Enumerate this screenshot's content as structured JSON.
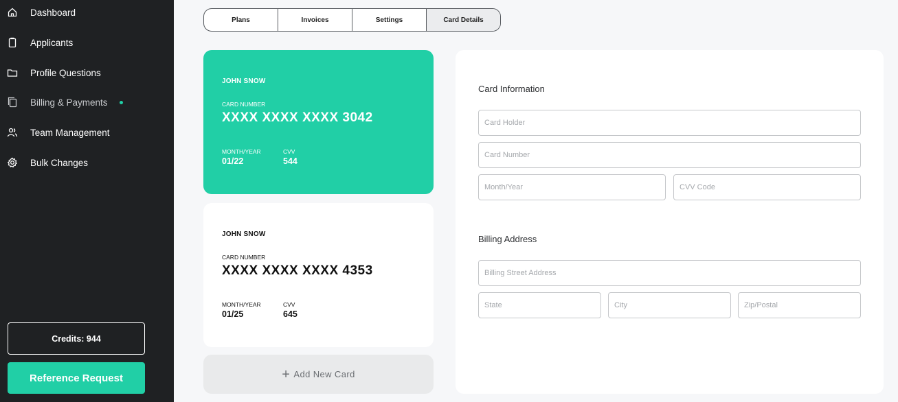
{
  "sidebar": {
    "items": [
      {
        "label": "Dashboard",
        "icon": "home-icon"
      },
      {
        "label": "Applicants",
        "icon": "clipboard-icon"
      },
      {
        "label": "Profile Questions",
        "icon": "folder-icon"
      },
      {
        "label": "Billing & Payments",
        "icon": "copy-icon"
      },
      {
        "label": "Team Management",
        "icon": "users-icon"
      },
      {
        "label": "Bulk Changes",
        "icon": "gear-icon"
      }
    ],
    "credits_label": "Credits: 944",
    "reference_button": "Reference Request"
  },
  "tabs": [
    "Plans",
    "Invoices",
    "Settings",
    "Card Details"
  ],
  "cards": [
    {
      "holder": "JOHN SNOW",
      "number_label": "CARD NUMBER",
      "number": "XXXX XXXX XXXX 3042",
      "expiry_label": "MONTH/YEAR",
      "expiry": "01/22",
      "cvv_label": "CVV",
      "cvv": "544"
    },
    {
      "holder": "JOHN SNOW",
      "number_label": "CARD NUMBER",
      "number": "XXXX XXXX XXXX 4353",
      "expiry_label": "MONTH/YEAR",
      "expiry": "01/25",
      "cvv_label": "CVV",
      "cvv": "645"
    }
  ],
  "add_card": {
    "plus": "+",
    "label": "Add New Card"
  },
  "form": {
    "card_info_title": "Card Information",
    "card_holder_placeholder": "Card Holder",
    "card_number_placeholder": "Card Number",
    "month_year_placeholder": "Month/Year",
    "cvv_placeholder": "CVV Code",
    "billing_title": "Billing Address",
    "street_placeholder": "Billing Street Address",
    "state_placeholder": "State",
    "city_placeholder": "City",
    "zip_placeholder": "Zip/Postal"
  },
  "colors": {
    "sidebar_bg": "#1f2123",
    "accent": "#21cfa6",
    "page_bg": "#f6f7f9"
  }
}
